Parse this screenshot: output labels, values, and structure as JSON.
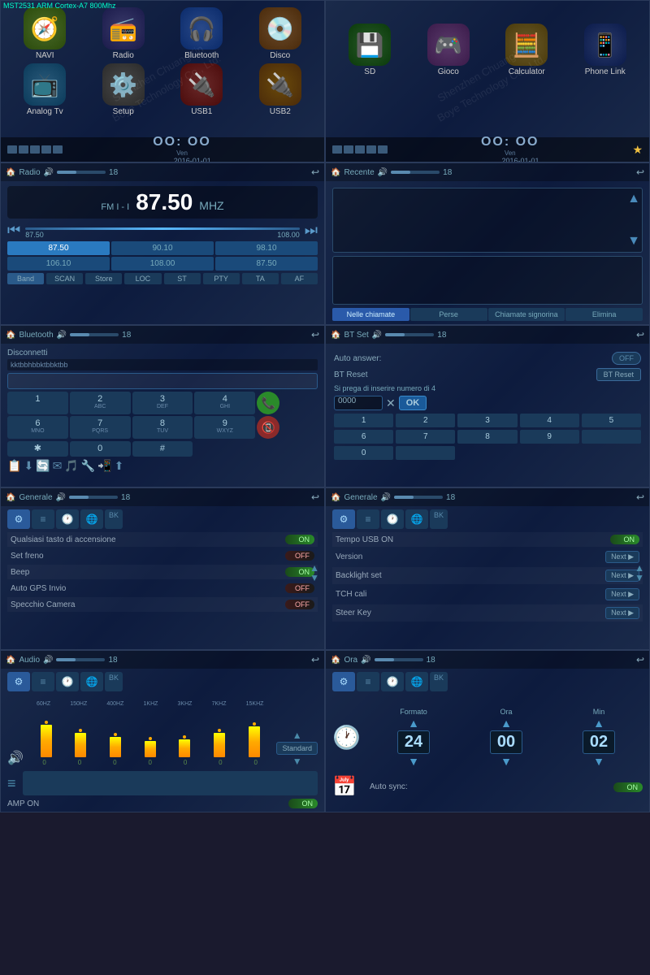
{
  "top_label": "MST2531 ARM Cortex-A7 800Mhz",
  "watermark": "Shenzhen ChuangXin Boye Technology Co., Ltd.",
  "panels": {
    "p1": {
      "items": [
        {
          "label": "NAVI",
          "icon": "🧭",
          "class": "icon-navi"
        },
        {
          "label": "Radio",
          "icon": "📻",
          "class": "icon-radio"
        },
        {
          "label": "Bluetooth",
          "icon": "🎧",
          "class": "icon-bt"
        },
        {
          "label": "Disco",
          "icon": "💿",
          "class": "icon-dvd"
        },
        {
          "label": "Analog Tv",
          "icon": "📺",
          "class": "icon-atv"
        },
        {
          "label": "Setup",
          "icon": "⚙️",
          "class": "icon-setup"
        },
        {
          "label": "USB1",
          "icon": "🔌",
          "class": "icon-usb"
        },
        {
          "label": "USB2",
          "icon": "🔌",
          "class": "icon-usb2"
        }
      ],
      "status": {
        "time": "OO: OO",
        "day": "Ven",
        "date": "2016-01-01"
      }
    },
    "p2": {
      "items": [
        {
          "label": "SD",
          "icon": "💾",
          "class": "icon-sd"
        },
        {
          "label": "Gioco",
          "icon": "🎮",
          "class": "icon-gioco"
        },
        {
          "label": "Calculator",
          "icon": "🧮",
          "class": "icon-calc"
        },
        {
          "label": "Phone Link",
          "icon": "📱",
          "class": "icon-phone"
        }
      ],
      "status": {
        "time": "OO: OO",
        "day": "Ven",
        "date": "2016-01-01"
      }
    },
    "p3": {
      "title": "Radio",
      "band": "FM I - I",
      "freq": "87.50",
      "unit": "MHZ",
      "range_min": "87.50",
      "range_max": "108.00",
      "presets": [
        "87.50",
        "90.10",
        "98.10",
        "106.10",
        "108.00",
        "87.50"
      ],
      "active_preset": 0,
      "buttons": [
        "Band",
        "SCAN",
        "Store",
        "LOC",
        "ST",
        "PTY",
        "TA",
        "AF"
      ],
      "volume": 18,
      "back": true
    },
    "p4": {
      "title": "Recente",
      "volume": 18,
      "tabs": [
        "Nelle chiamate",
        "Perse",
        "Chiamate signorina",
        "Elimina"
      ],
      "active_tab": 0
    },
    "p5": {
      "title": "Bluetooth",
      "volume": 18,
      "disconn_label": "Disconnetti",
      "device_id": "kktbbhbbktbbktbb",
      "numpad": [
        {
          "main": "1",
          "sub": ""
        },
        {
          "main": "2",
          "sub": "ABC"
        },
        {
          "main": "3",
          "sub": "DEF"
        },
        {
          "main": "4",
          "sub": "GHI"
        },
        {
          "main": "✱",
          "sub": ""
        }
      ],
      "numpad2": [
        {
          "main": "6",
          "sub": "MNO"
        },
        {
          "main": "7",
          "sub": "PQRS"
        },
        {
          "main": "8",
          "sub": "TUV"
        },
        {
          "main": "9",
          "sub": "WXYZ"
        },
        {
          "main": "0",
          "sub": "#"
        }
      ]
    },
    "p6": {
      "title": "BT Set",
      "volume": 18,
      "auto_answer_label": "Auto answer:",
      "auto_answer": "OFF",
      "bt_reset_label": "BT Reset",
      "bt_reset_btn": "BT Reset",
      "pin_hint": "Si prega di inserire numero di 4",
      "pin_value": "0000",
      "ok": "OK",
      "numpad": [
        "1",
        "2",
        "3",
        "4",
        "5",
        "6",
        "7",
        "8",
        "9",
        "",
        "0",
        ""
      ]
    },
    "p7": {
      "title": "Generale",
      "volume": 18,
      "settings": [
        {
          "label": "Qualsiasi tasto di accensione",
          "value": "ON",
          "type": "toggle_on"
        },
        {
          "label": "Set freno",
          "value": "OFF",
          "type": "toggle_off"
        },
        {
          "label": "Beep",
          "value": "ON",
          "type": "toggle_on"
        },
        {
          "label": "Auto GPS Invio",
          "value": "OFF",
          "type": "toggle_off"
        },
        {
          "label": "Specchio Camera",
          "value": "",
          "type": "none"
        }
      ]
    },
    "p8": {
      "title": "Generale",
      "volume": 18,
      "settings": [
        {
          "label": "Tempo USB ON",
          "value": "ON",
          "type": "toggle_on"
        },
        {
          "label": "Version",
          "value": "Next",
          "type": "next"
        },
        {
          "label": "Backlight set",
          "value": "Next",
          "type": "next"
        },
        {
          "label": "TCH cali",
          "value": "Next",
          "type": "next"
        },
        {
          "label": "Steer Key",
          "value": "Next",
          "type": "next"
        }
      ]
    },
    "p9": {
      "title": "Audio",
      "volume": 18,
      "eq_labels": [
        "60HZ",
        "150HZ",
        "400HZ",
        "1KHZ",
        "3KHZ",
        "7KHZ",
        "15KHZ"
      ],
      "eq_heights": [
        55,
        45,
        35,
        25,
        30,
        40,
        50
      ],
      "amp_on": "AMP ON",
      "amp_value": "ON",
      "standard": "Standard"
    },
    "p10": {
      "title": "Ora",
      "volume": 18,
      "formato_label": "Formato",
      "ora_label": "Ora",
      "min_label": "Min",
      "formato_val": "24",
      "ora_val": "00",
      "min_val": "02",
      "auto_sync_label": "Auto sync:",
      "auto_sync": "ON"
    }
  }
}
